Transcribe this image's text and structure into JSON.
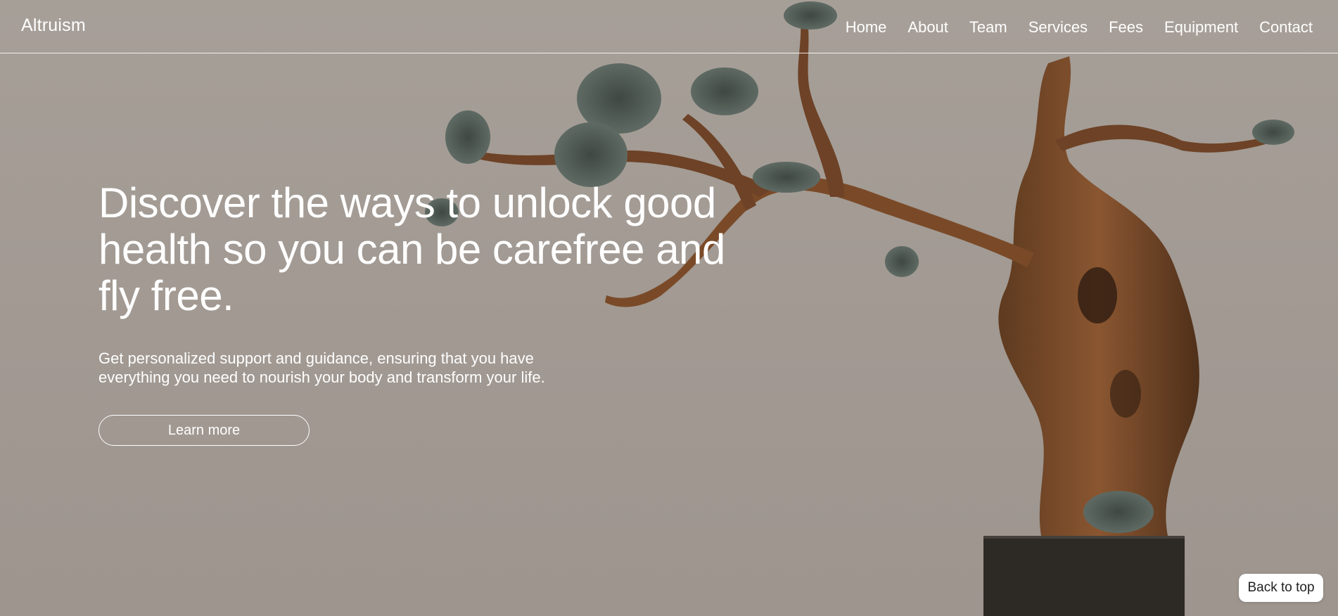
{
  "header": {
    "brand": "Altruism",
    "nav": [
      "Home",
      "About",
      "Team",
      "Services",
      "Fees",
      "Equipment",
      "Contact"
    ]
  },
  "hero": {
    "headline": "Discover the ways to unlock good health so you can be carefree and fly free.",
    "subtext": "Get personalized support and guidance, ensuring that you have everything you need to nourish your body and transform your life.",
    "cta_label": "Learn more",
    "background_image": "bonsai-tree-icon"
  },
  "back_to_top": "Back to top",
  "colors": {
    "background": "#a29a93",
    "text": "#ffffff",
    "wood": "#7a4a28",
    "foliage": "#4f5a55",
    "pot": "#2b2824"
  }
}
